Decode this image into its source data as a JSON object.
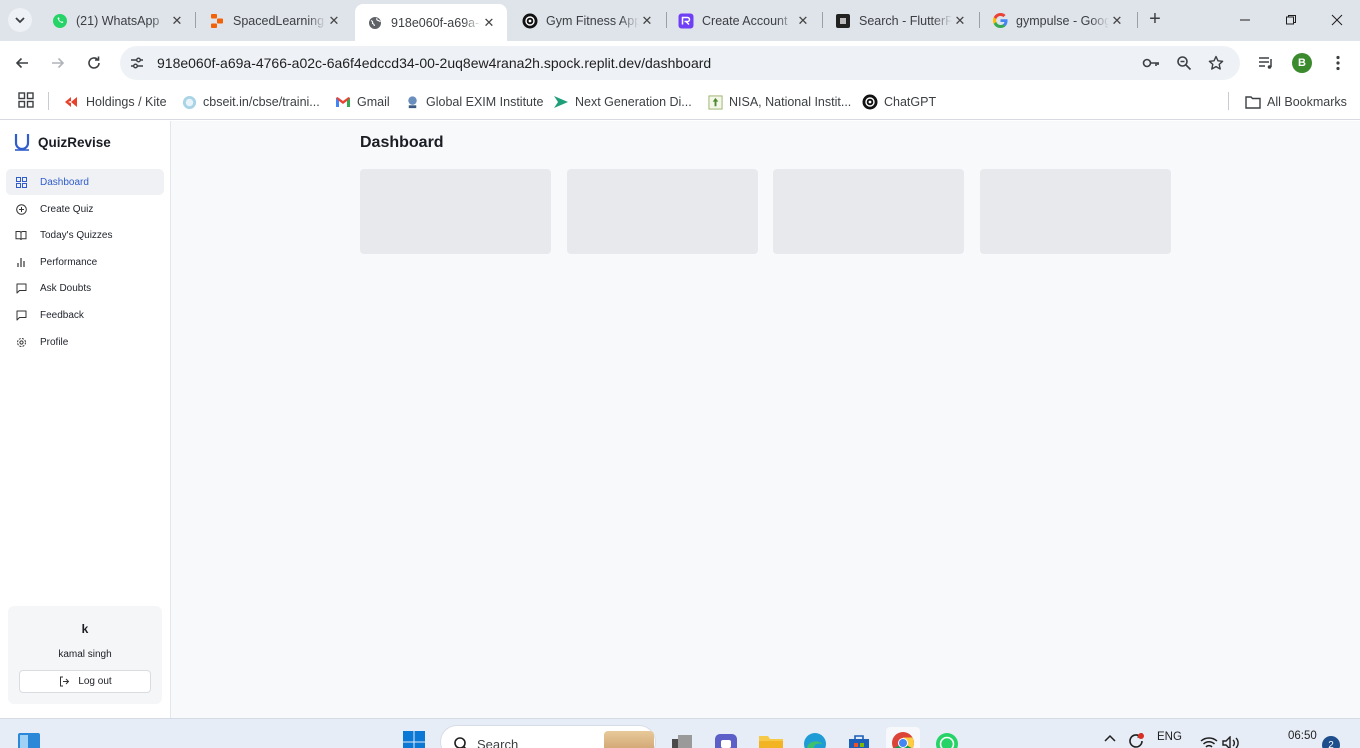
{
  "browser": {
    "tabs": [
      {
        "title": "(21) WhatsApp",
        "icon": "whatsapp-icon"
      },
      {
        "title": "SpacedLearning",
        "icon": "replit-icon"
      },
      {
        "title": "918e060f-a69a-4766-a02c-6a6f4edccd34-00-2uq8ew4rana2h.spock.replit.dev/dashboard",
        "icon": "globe-icon",
        "active": true
      },
      {
        "title": "Gym Fitness App",
        "icon": "openai-icon"
      },
      {
        "title": "Create Account",
        "icon": "app-icon"
      },
      {
        "title": "Search - FlutterFlow",
        "icon": "flutterflow-icon"
      },
      {
        "title": "gympulse - Google Search",
        "icon": "google-icon"
      }
    ],
    "url": "918e060f-a69a-4766-a02c-6a6f4edccd34-00-2uq8ew4rana2h.spock.replit.dev/dashboard",
    "profile_initial": "B",
    "bookmarks": [
      {
        "label": "Holdings / Kite",
        "icon": "kite-icon"
      },
      {
        "label": "cbseit.in/cbse/traini...",
        "icon": "cbse-icon"
      },
      {
        "label": "Gmail",
        "icon": "gmail-icon"
      },
      {
        "label": "Global EXIM Institute",
        "icon": "exim-icon"
      },
      {
        "label": "Next Generation Di...",
        "icon": "arrow-icon"
      },
      {
        "label": "NISA, National Instit...",
        "icon": "nisa-icon"
      },
      {
        "label": "ChatGPT",
        "icon": "openai-icon"
      }
    ],
    "all_bookmarks": "All Bookmarks"
  },
  "app": {
    "brand": "QuizRevise",
    "nav": [
      {
        "label": "Dashboard",
        "icon": "grid-icon",
        "active": true
      },
      {
        "label": "Create Quiz",
        "icon": "plus-circle-icon"
      },
      {
        "label": "Today's Quizzes",
        "icon": "book-icon"
      },
      {
        "label": "Performance",
        "icon": "bar-chart-icon"
      },
      {
        "label": "Ask Doubts",
        "icon": "chat-icon"
      },
      {
        "label": "Feedback",
        "icon": "message-icon"
      },
      {
        "label": "Profile",
        "icon": "gear-icon"
      }
    ],
    "user": {
      "initial": "k",
      "name": "kamal singh",
      "logout": "Log out"
    },
    "page_title": "Dashboard",
    "cards_count_note": ""
  },
  "taskbar": {
    "search_placeholder": "Search",
    "language": "ENG",
    "time": "06:50",
    "notification_count": "2"
  },
  "colors": {
    "accent": "#2f5dcb",
    "skeleton": "#e8e9ec",
    "profile": "#3b8a2e"
  }
}
